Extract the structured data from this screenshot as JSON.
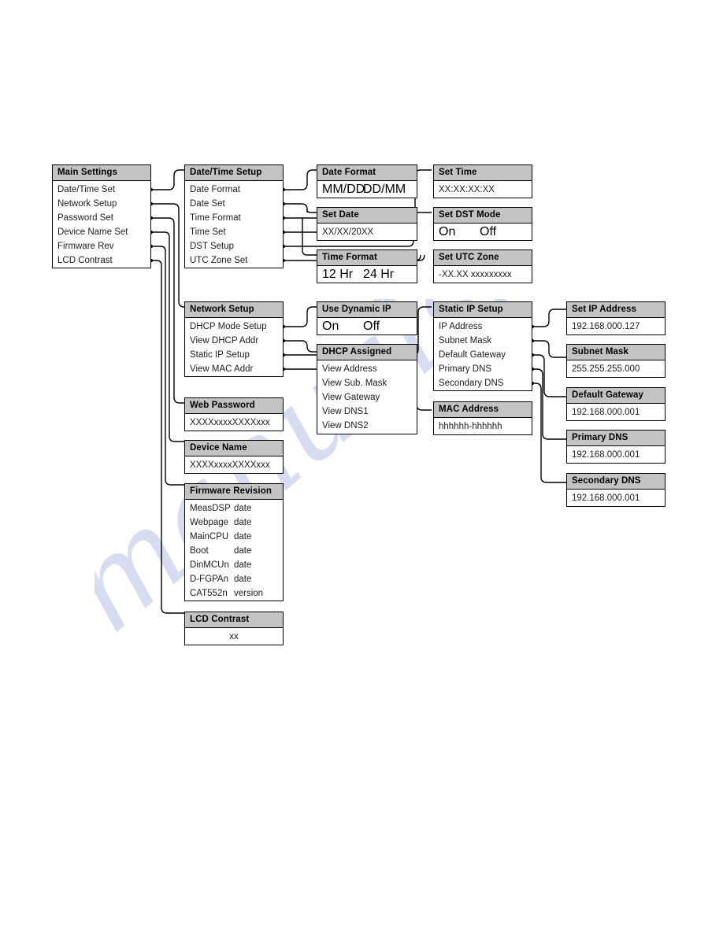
{
  "watermark": {
    "text": "manualshive.com"
  },
  "colors": {
    "header_fill": "#c3c3c3",
    "border": "#000000",
    "page_bg": "#ffffff",
    "watermark": "#b9c0e6"
  },
  "boxes": {
    "main_settings": {
      "title": "Main Settings",
      "items": [
        "Date/Time Set",
        "Network Setup",
        "Password Set",
        "Device Name Set",
        "Firmware Rev",
        "LCD Contrast"
      ]
    },
    "date_time_setup": {
      "title": "Date/Time Setup",
      "items": [
        "Date Format",
        "Date Set",
        "Time Format",
        "Time Set",
        "DST Setup",
        "UTC Zone Set"
      ]
    },
    "date_format": {
      "title": "Date Format",
      "option_a": "MM/DD",
      "option_b": "DD/MM"
    },
    "set_date": {
      "title": "Set Date",
      "value": "XX/XX/20XX"
    },
    "time_format": {
      "title": "Time Format",
      "option_a": "12 Hr",
      "option_b": "24 Hr"
    },
    "set_time": {
      "title": "Set Time",
      "value": "XX:XX:XX:XX"
    },
    "set_dst_mode": {
      "title": "Set DST Mode",
      "option_a": "On",
      "option_b": "Off"
    },
    "set_utc_zone": {
      "title": "Set UTC Zone",
      "value": "-XX.XX xxxxxxxxx"
    },
    "network_setup": {
      "title": "Network Setup",
      "items": [
        "DHCP Mode Setup",
        "View DHCP Addr",
        "Static IP Setup",
        "View MAC Addr"
      ]
    },
    "use_dynamic_ip": {
      "title": "Use Dynamic IP",
      "option_a": "On",
      "option_b": "Off"
    },
    "dhcp_assigned": {
      "title": "DHCP Assigned",
      "items": [
        "View Address",
        "View Sub. Mask",
        "View Gateway",
        "View DNS1",
        "View DNS2"
      ]
    },
    "static_ip_setup": {
      "title": "Static IP Setup",
      "items": [
        "IP Address",
        "Subnet Mask",
        "Default Gateway",
        "Primary DNS",
        "Secondary DNS"
      ]
    },
    "mac_address": {
      "title": "MAC Address",
      "value": "hhhhhh-hhhhhh"
    },
    "set_ip_address": {
      "title": "Set IP Address",
      "value": "192.168.000.127"
    },
    "subnet_mask": {
      "title": "Subnet Mask",
      "value": "255.255.255.000"
    },
    "default_gateway": {
      "title": "Default Gateway",
      "value": "192.168.000.001"
    },
    "primary_dns": {
      "title": "Primary DNS",
      "value": "192.168.000.001"
    },
    "secondary_dns": {
      "title": "Secondary DNS",
      "value": "192.168.000.001"
    },
    "web_password": {
      "title": "Web Password",
      "value": "XXXXxxxxXXXXxxx"
    },
    "device_name": {
      "title": "Device Name",
      "value": "XXXXxxxxXXXXxxx"
    },
    "firmware_revision": {
      "title": "Firmware Revision",
      "rows": [
        {
          "name": "MeasDSP",
          "value": "date"
        },
        {
          "name": "Webpage",
          "value": "date"
        },
        {
          "name": "MainCPU",
          "value": "date"
        },
        {
          "name": "Boot",
          "value": "date"
        },
        {
          "name": "DinMCUn",
          "value": "date"
        },
        {
          "name": "D-FGPAn",
          "value": "date"
        },
        {
          "name": "CAT552n",
          "value": "version"
        }
      ]
    },
    "lcd_contrast": {
      "title": "LCD Contrast",
      "value": "xx"
    }
  }
}
